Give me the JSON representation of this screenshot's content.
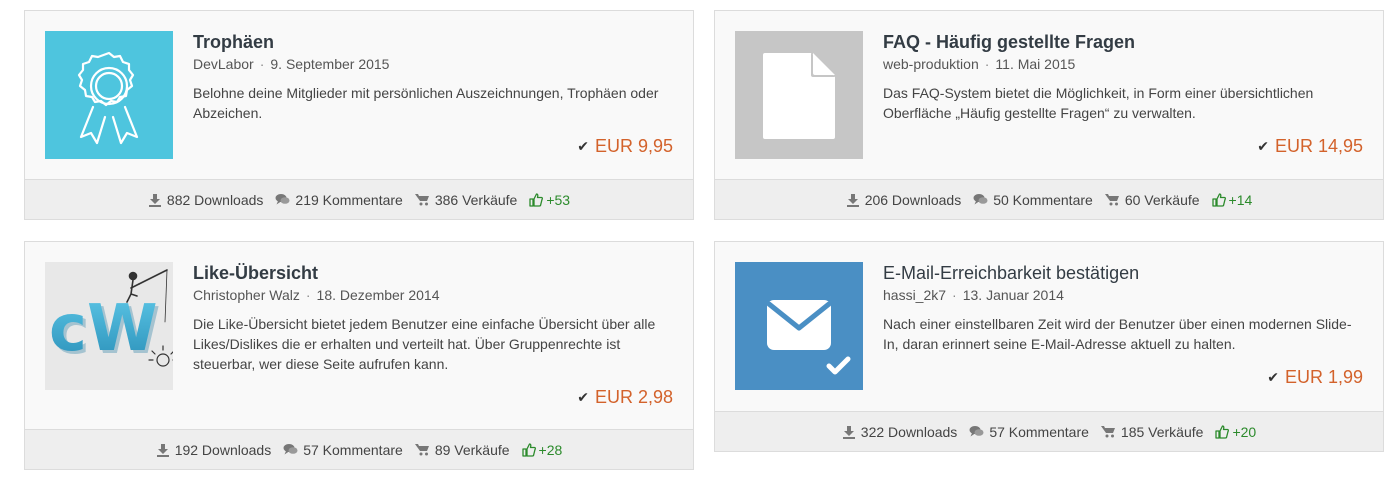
{
  "items": [
    {
      "title": "Trophäen",
      "author": "DevLabor",
      "date": "9. September 2015",
      "description": "Belohne deine Mitglieder mit persönlichen Auszeichnungen, Trophäen oder Abzeichen.",
      "price": "EUR 9,95",
      "downloads": "882 Downloads",
      "comments": "219 Kommentare",
      "sales": "386 Verkäufe",
      "likes": "+53",
      "thumb_icon": "award-ribbon-icon",
      "thumb_color": "#4ec5de"
    },
    {
      "title": "FAQ - Häufig gestellte Fragen",
      "author": "web-produktion",
      "date": "11. Mai 2015",
      "description": "Das FAQ-System bietet die Möglichkeit, in Form einer übersichtlichen Oberfläche „Häufig gestellte Fragen“ zu verwalten.",
      "price": "EUR 14,95",
      "downloads": "206 Downloads",
      "comments": "50 Kommentare",
      "sales": "60 Verkäufe",
      "likes": "+14",
      "thumb_icon": "document-icon",
      "thumb_color": "#c6c6c6"
    },
    {
      "title": "Like-Übersicht",
      "author": "Christopher Walz",
      "date": "18. Dezember 2014",
      "description": "Die Like-Übersicht bietet jedem Benutzer eine einfache Übersicht über alle Likes/Dislikes die er erhalten und verteilt hat. Über Gruppenrechte ist steuerbar, wer diese Seite aufrufen kann.",
      "price": "EUR 2,98",
      "downloads": "192 Downloads",
      "comments": "57 Kommentare",
      "sales": "89 Verkäufe",
      "likes": "+28",
      "thumb_icon": "cw-logo",
      "thumb_color": "#e8e8e8"
    },
    {
      "title": "E-Mail-Erreichbarkeit bestätigen",
      "author": "hassi_2k7",
      "date": "13. Januar 2014",
      "description": "Nach einer einstellbaren Zeit wird der Benutzer über einen modernen Slide-In, daran erinnert seine E-Mail-Adresse aktuell zu halten.",
      "price": "EUR 1,99",
      "downloads": "322 Downloads",
      "comments": "57 Kommentare",
      "sales": "185 Verkäufe",
      "likes": "+20",
      "thumb_icon": "envelope-check-icon",
      "thumb_color": "#4a8fc4"
    }
  ],
  "cw_logo_text": "cW",
  "colors": {
    "price": "#d3622b",
    "likes": "#2b8a2b",
    "card_bg": "#f9f9f9",
    "footer_bg": "#eeeeee"
  }
}
